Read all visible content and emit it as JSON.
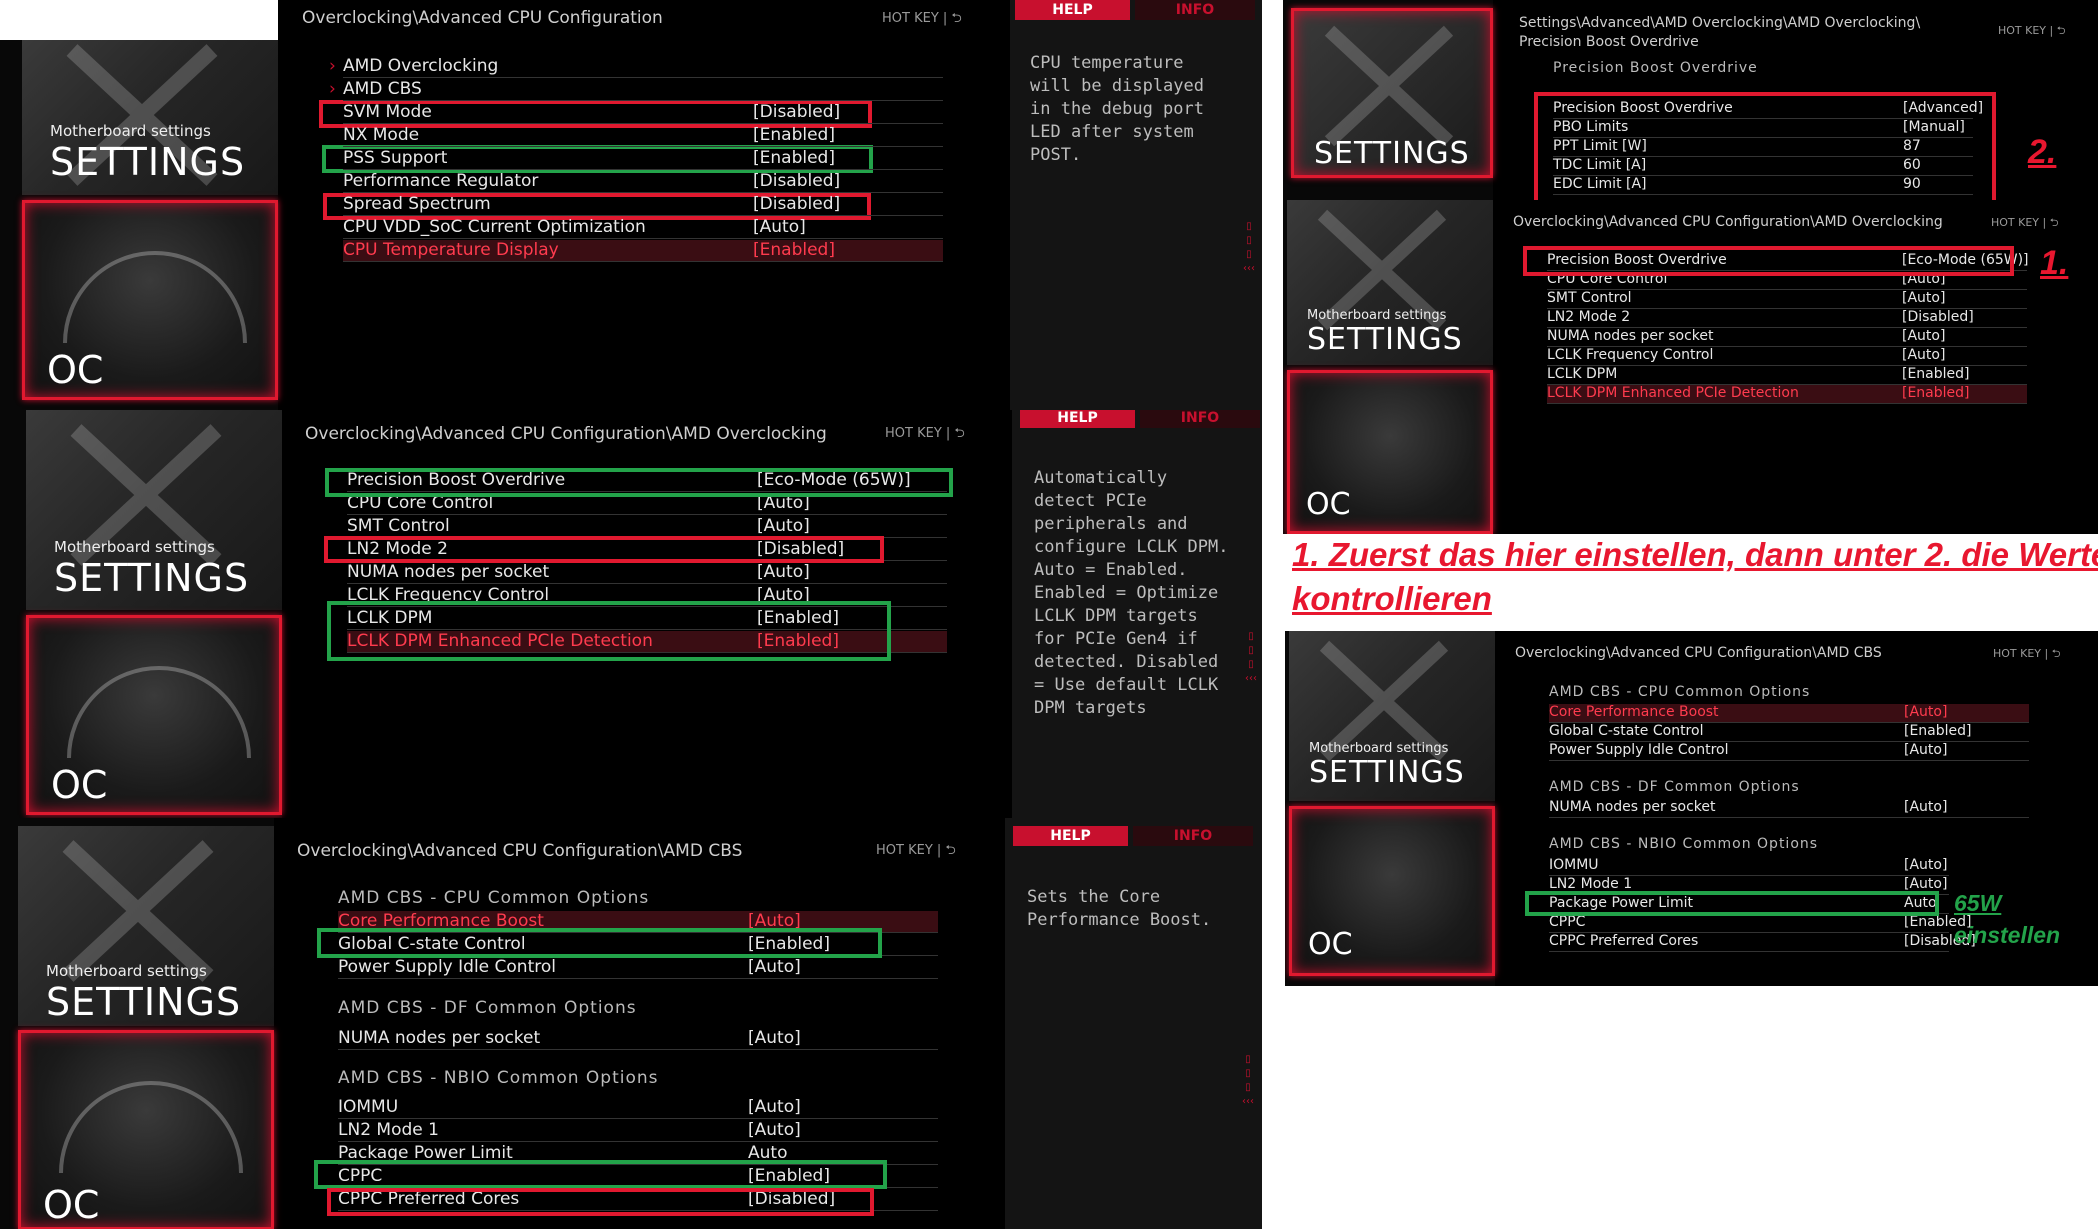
{
  "tiles": {
    "mb_label": "Motherboard settings",
    "settings": "SETTINGS",
    "oc": "OC"
  },
  "hotkey": "HOT KEY  |  ⮌",
  "help_tab": "HELP",
  "info_tab": "INFO",
  "p1": {
    "path": "Overclocking\\Advanced CPU Configuration",
    "rows": [
      {
        "k": "AMD Overclocking",
        "v": ""
      },
      {
        "k": "AMD CBS",
        "v": ""
      },
      {
        "k": "SVM Mode",
        "v": "[Disabled]"
      },
      {
        "k": "NX Mode",
        "v": "[Enabled]"
      },
      {
        "k": "PSS Support",
        "v": "[Enabled]"
      },
      {
        "k": "Performance Regulator",
        "v": "[Disabled]"
      },
      {
        "k": "Spread Spectrum",
        "v": "[Disabled]"
      },
      {
        "k": "CPU VDD_SoC Current Optimization",
        "v": "[Auto]"
      },
      {
        "k": "CPU Temperature Display",
        "v": "[Enabled]"
      }
    ],
    "help": "CPU temperature\nwill be displayed\nin the debug port\nLED after system\nPOST."
  },
  "p2": {
    "path": "Overclocking\\Advanced CPU Configuration\\AMD Overclocking",
    "rows": [
      {
        "k": "Precision Boost Overdrive",
        "v": "[Eco-Mode (65W)]"
      },
      {
        "k": "CPU Core Control",
        "v": "[Auto]"
      },
      {
        "k": "SMT Control",
        "v": "[Auto]"
      },
      {
        "k": "LN2 Mode 2",
        "v": "[Disabled]"
      },
      {
        "k": "NUMA nodes per socket",
        "v": "[Auto]"
      },
      {
        "k": "LCLK Frequency Control",
        "v": "[Auto]"
      },
      {
        "k": "LCLK DPM",
        "v": "[Enabled]"
      },
      {
        "k": "LCLK DPM Enhanced PCIe Detection",
        "v": "[Enabled]"
      }
    ],
    "help": "Automatically\ndetect PCIe\nperipherals and\nconfigure LCLK DPM.\nAuto = Enabled.\nEnabled = Optimize\nLCLK DPM targets\nfor PCIe Gen4 if\ndetected. Disabled\n= Use default LCLK\nDPM targets"
  },
  "p3": {
    "path": "Overclocking\\Advanced CPU Configuration\\AMD CBS",
    "g1": "AMD CBS - CPU Common Options",
    "g2": "AMD CBS - DF Common Options",
    "g3": "AMD CBS - NBIO Common Options",
    "r1": [
      {
        "k": "Core Performance Boost",
        "v": "[Auto]"
      },
      {
        "k": "Global C-state Control",
        "v": "[Enabled]"
      },
      {
        "k": "Power Supply Idle Control",
        "v": "[Auto]"
      }
    ],
    "r2": [
      {
        "k": "NUMA nodes per socket",
        "v": "[Auto]"
      }
    ],
    "r3": [
      {
        "k": "IOMMU",
        "v": "[Auto]"
      },
      {
        "k": "LN2 Mode 1",
        "v": "[Auto]"
      },
      {
        "k": "Package Power Limit",
        "v": "Auto"
      },
      {
        "k": "CPPC",
        "v": "[Enabled]"
      },
      {
        "k": "CPPC Preferred Cores",
        "v": "[Disabled]"
      }
    ],
    "help": "Sets the Core\nPerformance Boost."
  },
  "r1": {
    "path": "Settings\\Advanced\\AMD Overclocking\\AMD Overclocking\\\nPrecision Boost Overdrive",
    "sub": "Precision Boost Overdrive",
    "rows": [
      {
        "k": "Precision Boost Overdrive",
        "v": "[Advanced]"
      },
      {
        "k": "PBO Limits",
        "v": "[Manual]"
      },
      {
        "k": "PPT Limit [W]",
        "v": "87"
      },
      {
        "k": "TDC Limit [A]",
        "v": "60"
      },
      {
        "k": "EDC Limit [A]",
        "v": "90"
      }
    ]
  },
  "r2": {
    "path": "Overclocking\\Advanced CPU Configuration\\AMD Overclocking",
    "rows": [
      {
        "k": "Precision Boost Overdrive",
        "v": "[Eco-Mode (65W)]"
      },
      {
        "k": "CPU Core Control",
        "v": "[Auto]"
      },
      {
        "k": "SMT Control",
        "v": "[Auto]"
      },
      {
        "k": "LN2 Mode 2",
        "v": "[Disabled]"
      },
      {
        "k": "NUMA nodes per socket",
        "v": "[Auto]"
      },
      {
        "k": "LCLK Frequency Control",
        "v": "[Auto]"
      },
      {
        "k": "LCLK DPM",
        "v": "[Enabled]"
      },
      {
        "k": "LCLK DPM Enhanced PCIe Detection",
        "v": "[Enabled]"
      }
    ]
  },
  "r3": {
    "path": "Overclocking\\Advanced CPU Configuration\\AMD CBS",
    "g1": "AMD CBS - CPU Common Options",
    "g2": "AMD CBS - DF Common Options",
    "g3": "AMD CBS - NBIO Common Options",
    "r1": [
      {
        "k": "Core Performance Boost",
        "v": "[Auto]"
      },
      {
        "k": "Global C-state Control",
        "v": "[Enabled]"
      },
      {
        "k": "Power Supply Idle Control",
        "v": "[Auto]"
      }
    ],
    "r2": [
      {
        "k": "NUMA nodes per socket",
        "v": "[Auto]"
      }
    ],
    "r3": [
      {
        "k": "IOMMU",
        "v": "[Auto]"
      },
      {
        "k": "LN2 Mode 1",
        "v": "[Auto]"
      },
      {
        "k": "Package Power Limit",
        "v": "Auto"
      },
      {
        "k": "CPPC",
        "v": "[Enabled]"
      },
      {
        "k": "CPPC Preferred Cores",
        "v": "[Disabled]"
      }
    ]
  },
  "notes": {
    "n1": "1. Zuerst das hier einstellen, dann unter 2. die Werte",
    "n2": "kontrollieren",
    "n65a": "65W",
    "n65b": "einstellen",
    "lbl1": "1.",
    "lbl2": "2."
  }
}
